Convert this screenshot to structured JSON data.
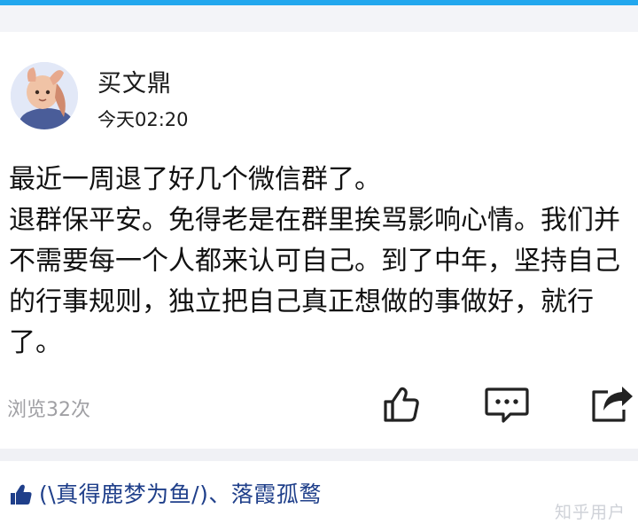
{
  "post": {
    "author": "买文鼎",
    "timestamp": "今天02:20",
    "content": "最近一周退了好几个微信群了。\n退群保平安。免得老是在群里挨骂影响心情。我们并不需要每一个人都来认可自己。到了中年，坚持自己的行事规则，独立把自己真正想做的事做好，就行了。",
    "views": "浏览32次",
    "actions": {
      "like_icon": "thumbs-up-icon",
      "comment_icon": "comment-icon",
      "share_icon": "share-icon"
    }
  },
  "likes": {
    "icon": "thumbs-up-icon",
    "text": "(\\真得鹿梦为鱼/)、落霞孤鹜"
  },
  "watermark": "知乎用户",
  "colors": {
    "accent": "#22a7ee",
    "likes_text": "#1f3f8a",
    "icon": "#222222",
    "muted": "#a0a0a4"
  }
}
